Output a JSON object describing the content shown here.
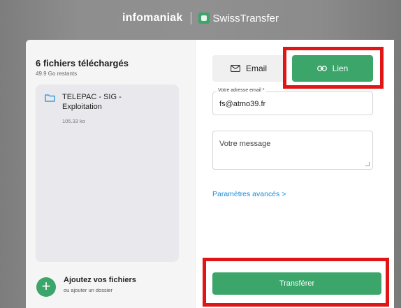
{
  "header": {
    "brand": "infomaniak",
    "app_name": "SwissTransfer"
  },
  "upload": {
    "title": "6 fichiers téléchargés",
    "remaining": "49.9 Go restants",
    "files": [
      {
        "name": "TELEPAC - SIG - Exploitation",
        "size": "105.33 ko"
      }
    ],
    "add_title": "Ajoutez vos fichiers",
    "add_sub": "ou ajouter un dossier",
    "add_symbol": "+"
  },
  "form": {
    "tab_email": "Email",
    "tab_link": "Lien",
    "email_label": "Votre adresse email *",
    "email_value": "fs@atmo39.fr",
    "message_placeholder": "Votre message",
    "advanced_link": "Paramètres avancés >",
    "submit_label": "Transférer"
  },
  "colors": {
    "accent": "#3ba56a",
    "link": "#1a8bd6",
    "highlight": "#e01616"
  },
  "icons": {
    "folder": "folder-icon",
    "envelope": "envelope-icon",
    "link": "link-icon",
    "add": "plus-icon"
  }
}
